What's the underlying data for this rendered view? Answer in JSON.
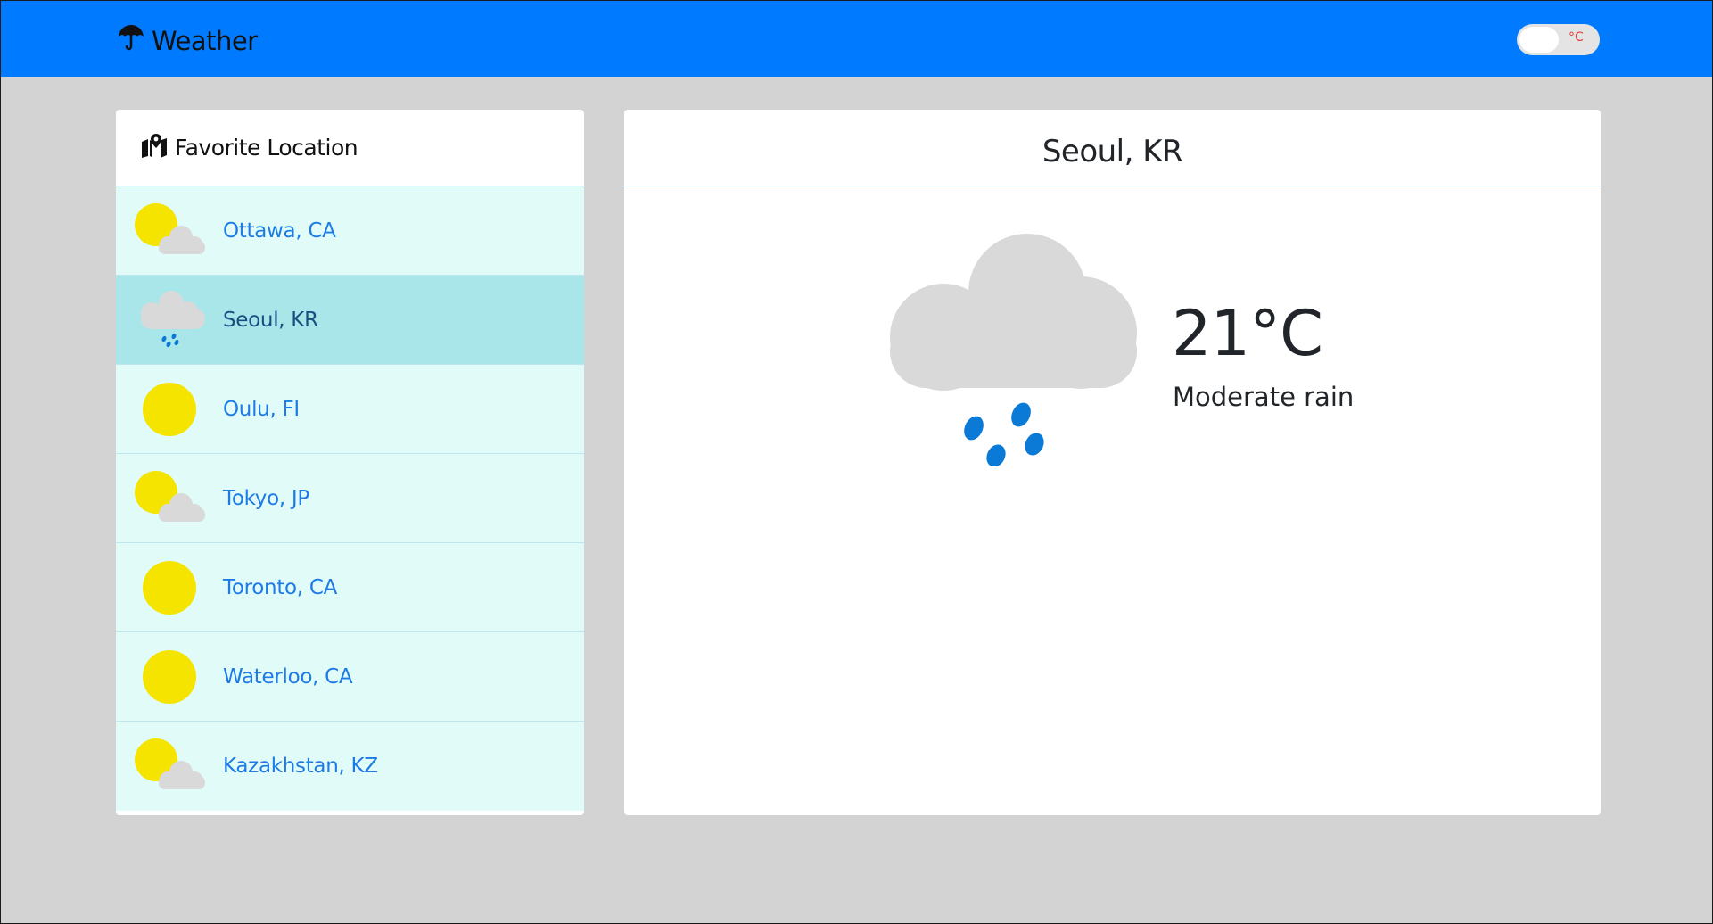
{
  "app": {
    "title": "Weather",
    "unit_toggle_label": "°C"
  },
  "favorites": {
    "header": "Favorite Location",
    "items": [
      {
        "name": "Ottawa, CA",
        "icon": "partly-cloudy-icon",
        "active": false
      },
      {
        "name": "Seoul, KR",
        "icon": "rain-icon",
        "active": true
      },
      {
        "name": "Oulu, FI",
        "icon": "sun-icon",
        "active": false
      },
      {
        "name": "Tokyo, JP",
        "icon": "partly-cloudy-icon",
        "active": false
      },
      {
        "name": "Toronto, CA",
        "icon": "sun-icon",
        "active": false
      },
      {
        "name": "Waterloo, CA",
        "icon": "sun-icon",
        "active": false
      },
      {
        "name": "Kazakhstan, KZ",
        "icon": "partly-cloudy-icon",
        "active": false
      }
    ]
  },
  "detail": {
    "location": "Seoul, KR",
    "temperature": "21°C",
    "condition": "Moderate rain",
    "icon": "rain-icon"
  },
  "colors": {
    "navbar": "#007bff",
    "background": "#d3d3d3",
    "list_item": "#e0fbf8",
    "list_item_active": "#a8e6ea",
    "link": "#1e7be6",
    "sun": "#f5e400",
    "cloud": "#d9d9d9",
    "rain": "#0a7ad6"
  }
}
